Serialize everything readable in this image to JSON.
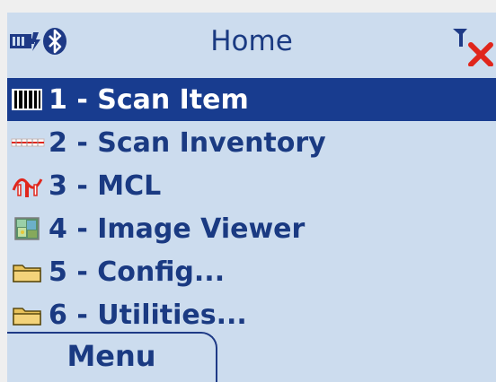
{
  "status": {
    "title": "Home",
    "battery_icon": "battery-charging-icon",
    "bluetooth_icon": "bluetooth-icon",
    "signal_icon": "antenna-no-signal-icon"
  },
  "menu": {
    "selected_index": 0,
    "items": [
      {
        "label": "1 - Scan Item",
        "icon": "barcode-icon"
      },
      {
        "label": "2 - Scan Inventory",
        "icon": "scanner-line-icon"
      },
      {
        "label": "3 - MCL",
        "icon": "mcl-icon"
      },
      {
        "label": "4 - Image Viewer",
        "icon": "image-icon"
      },
      {
        "label": "5 - Config...",
        "icon": "folder-icon"
      },
      {
        "label": "6 - Utilities...",
        "icon": "folder-icon"
      }
    ]
  },
  "softkey": {
    "label": "Menu"
  },
  "colors": {
    "screen_bg": "#ccdcee",
    "text": "#1a3a82",
    "selected_bg": "#183c8f",
    "selected_text": "#ffffff",
    "error_red": "#e0261c"
  }
}
